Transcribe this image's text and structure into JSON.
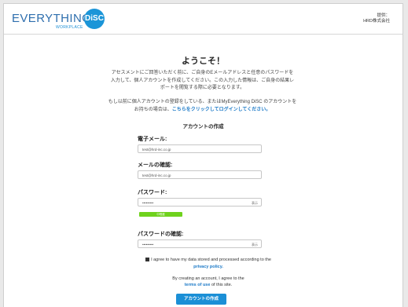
{
  "brand": {
    "logo_text": "EVERYTHING",
    "logo_badge": "DiSC",
    "logo_sub": "WORKPLACE",
    "provided_by_line1": "提供：",
    "provided_by_line2": "HRD株式会社"
  },
  "welcome": {
    "title": "ようこそ！",
    "intro": "アセスメントにご回答いただく前に、ご自身のEメールアドレスと任意のパスワードを入力して、個人アカウントを作成してください。この入力した情報は、ご自身の結果レポートを閲覧する際に必要となります。",
    "signin_prefix": "もし以前に個人アカウントの登録をしている、またはMyEverything DiSC のアカウントをお持ちの場合は、",
    "signin_link": "こちらをクリックしてログインしてください。"
  },
  "form": {
    "section_title": "アカウントの作成",
    "email_label": "電子メール:",
    "email_value": "test@hrd-inc.co.jp",
    "confirm_email_label": "メールの確認:",
    "confirm_email_value": "test@hrd-inc.co.jp",
    "password_label": "パスワード:",
    "password_value": "•••••••••",
    "password_show": "表示",
    "strength_label": "中程度",
    "strength_level": 0.35,
    "confirm_password_label": "パスワードの確認:",
    "confirm_password_value": "•••••••••",
    "confirm_password_show": "表示",
    "agree_text": "I agree to have my data stored and processed according to the",
    "agree_link": "privacy policy.",
    "agree_checked": true,
    "terms_text": "By creating an account, I agree to the",
    "terms_link": "terms of use",
    "terms_suffix": "of this site.",
    "submit_label": "アカウントの作成"
  },
  "colors": {
    "accent": "#1b8fd6",
    "link": "#1b79c7",
    "strength": "#6fd21d"
  }
}
